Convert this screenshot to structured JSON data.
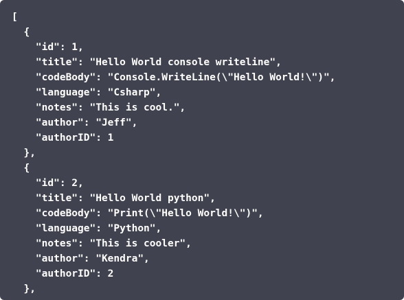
{
  "code_lines": [
    "[",
    "  {",
    "    \"id\": 1,",
    "    \"title\": \"Hello World console writeline\",",
    "    \"codeBody\": \"Console.WriteLine(\\\"Hello World!\\\")\",",
    "    \"language\": \"Csharp\",",
    "    \"notes\": \"This is cool.\",",
    "    \"author\": \"Jeff\",",
    "    \"authorID\": 1",
    "  },",
    "  {",
    "    \"id\": 2,",
    "    \"title\": \"Hello World python\",",
    "    \"codeBody\": \"Print(\\\"Hello World!\\\")\",",
    "    \"language\": \"Python\",",
    "    \"notes\": \"This is cooler\",",
    "    \"author\": \"Kendra\",",
    "    \"authorID\": 2",
    "  },"
  ],
  "colors": {
    "background": "#40434f",
    "text": "#ffffff"
  }
}
